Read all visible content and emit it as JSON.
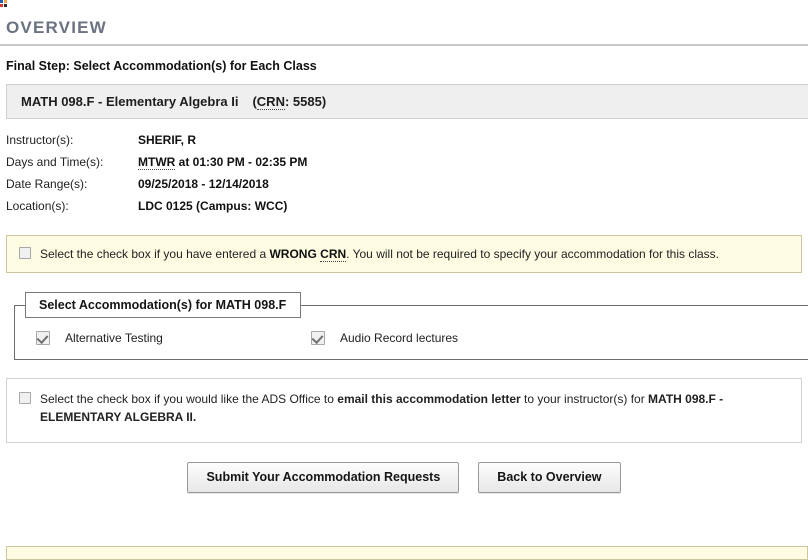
{
  "page": {
    "overview_heading": "OVERVIEW",
    "final_step_heading": "Final Step: Select Accommodation(s) for Each Class"
  },
  "class_header": {
    "course": "MATH 098.F - Elementary Algebra Ii",
    "crn_prefix": "CRN",
    "crn_rest": ": 5585",
    "crn_open_paren": "(",
    "crn_close_paren": ")"
  },
  "details": [
    {
      "label": "Instructor(s):",
      "value": "SHERIF, R"
    },
    {
      "label": "Days and Time(s):",
      "value_underlined": "MTWR",
      "value_rest": " at 01:30 PM - 02:35 PM"
    },
    {
      "label": "Date Range(s):",
      "value": "09/25/2018 - 12/14/2018"
    },
    {
      "label": "Location(s):",
      "value": "LDC 0125 (Campus: WCC)"
    }
  ],
  "wrong_crn_alert": {
    "text_before": "Select the check box if you have entered a ",
    "bold_wrong": "WRONG ",
    "bold_crn": "CRN",
    "text_after": ". You will not be required to specify your accommodation for this class.",
    "checked": false
  },
  "accommodation_fieldset": {
    "legend": "Select Accommodation(s) for MATH 098.F",
    "items": [
      {
        "label": "Alternative Testing",
        "checked": true
      },
      {
        "label": "Audio Record lectures",
        "checked": true
      }
    ]
  },
  "email_letter": {
    "text_before": "Select the check box if you would like the ADS Office to ",
    "bold_mid": "email this accommodation letter",
    "text_mid": " to your instructor(s) for ",
    "bold_course": "MATH 098.F - ELEMENTARY ALGEBRA II.",
    "checked": false
  },
  "buttons": {
    "submit": "Submit Your Accommodation Requests",
    "back": "Back to Overview"
  },
  "colors": {
    "heading_gray": "#6b7280",
    "alert_yellow_bg": "#fdfce3",
    "alert_yellow_border": "#cbc8a0",
    "class_header_bg": "#efefef",
    "fieldset_border": "#6d6d6d"
  }
}
